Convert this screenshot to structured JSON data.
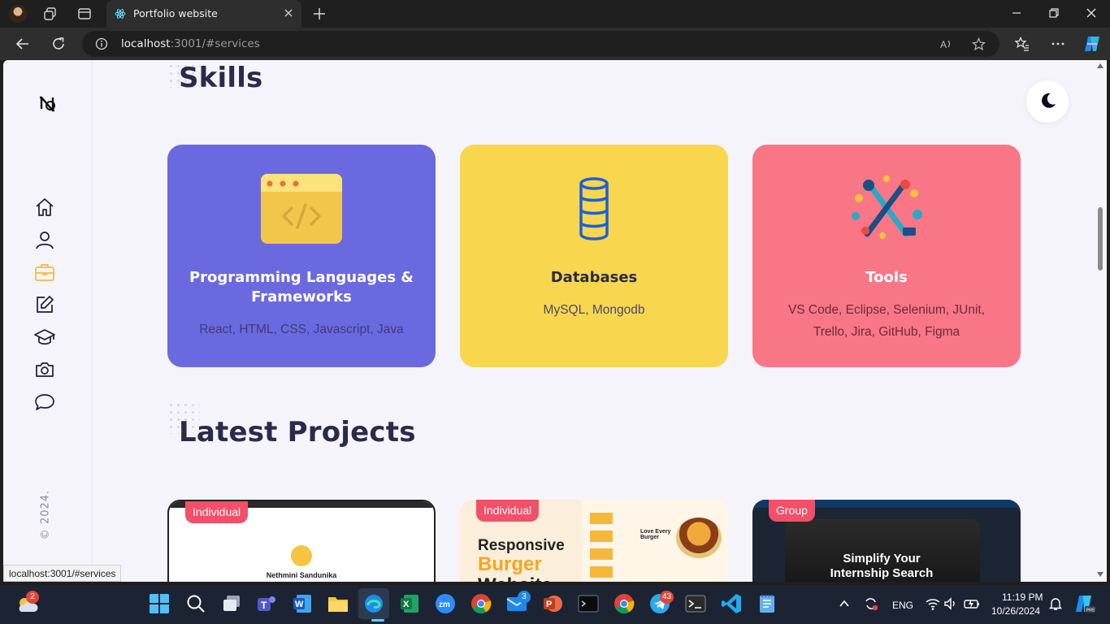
{
  "browser": {
    "tab_title": "Portfolio website",
    "url_host": "localhost",
    "url_rest": ":3001/#services",
    "status_url": "localhost:3001/#services"
  },
  "sidebar": {
    "copyright": "© 2024.",
    "items": [
      "home-icon",
      "user-icon",
      "briefcase-icon",
      "edit-icon",
      "graduation-cap-icon",
      "camera-icon",
      "chat-icon"
    ],
    "active_item": "briefcase-icon",
    "active_color": "#f5b942"
  },
  "skills": {
    "heading": "Skills",
    "cards": [
      {
        "title": "Programming Languages & Frameworks",
        "desc": "React, HTML, CSS, Javascript, Java",
        "bg": "#6b69e0"
      },
      {
        "title": "Databases",
        "desc": "MySQL, Mongodb",
        "bg": "#f8d64e"
      },
      {
        "title": "Tools",
        "desc": "VS Code, Eclipse, Selenium, JUnit, Trello, Jira, GitHub, Figma",
        "bg": "#f97686"
      }
    ]
  },
  "projects": {
    "heading": "Latest Projects",
    "cards": [
      {
        "badge": "Individual",
        "preview_name": "Nethmini Sandunika"
      },
      {
        "badge": "Individual",
        "preview_l1": "Responsive",
        "preview_l2": "Burger",
        "preview_l3": "Website",
        "preview_tag": "Love Every Burger"
      },
      {
        "badge": "Group",
        "preview_l1": "Simplify Your",
        "preview_l2": "Internship Search"
      }
    ]
  },
  "taskbar": {
    "weather_badge": "2",
    "mail_badge": "3",
    "telegram_badge": "43",
    "language": "ENG",
    "time": "11:19 PM",
    "date": "10/26/2024"
  }
}
